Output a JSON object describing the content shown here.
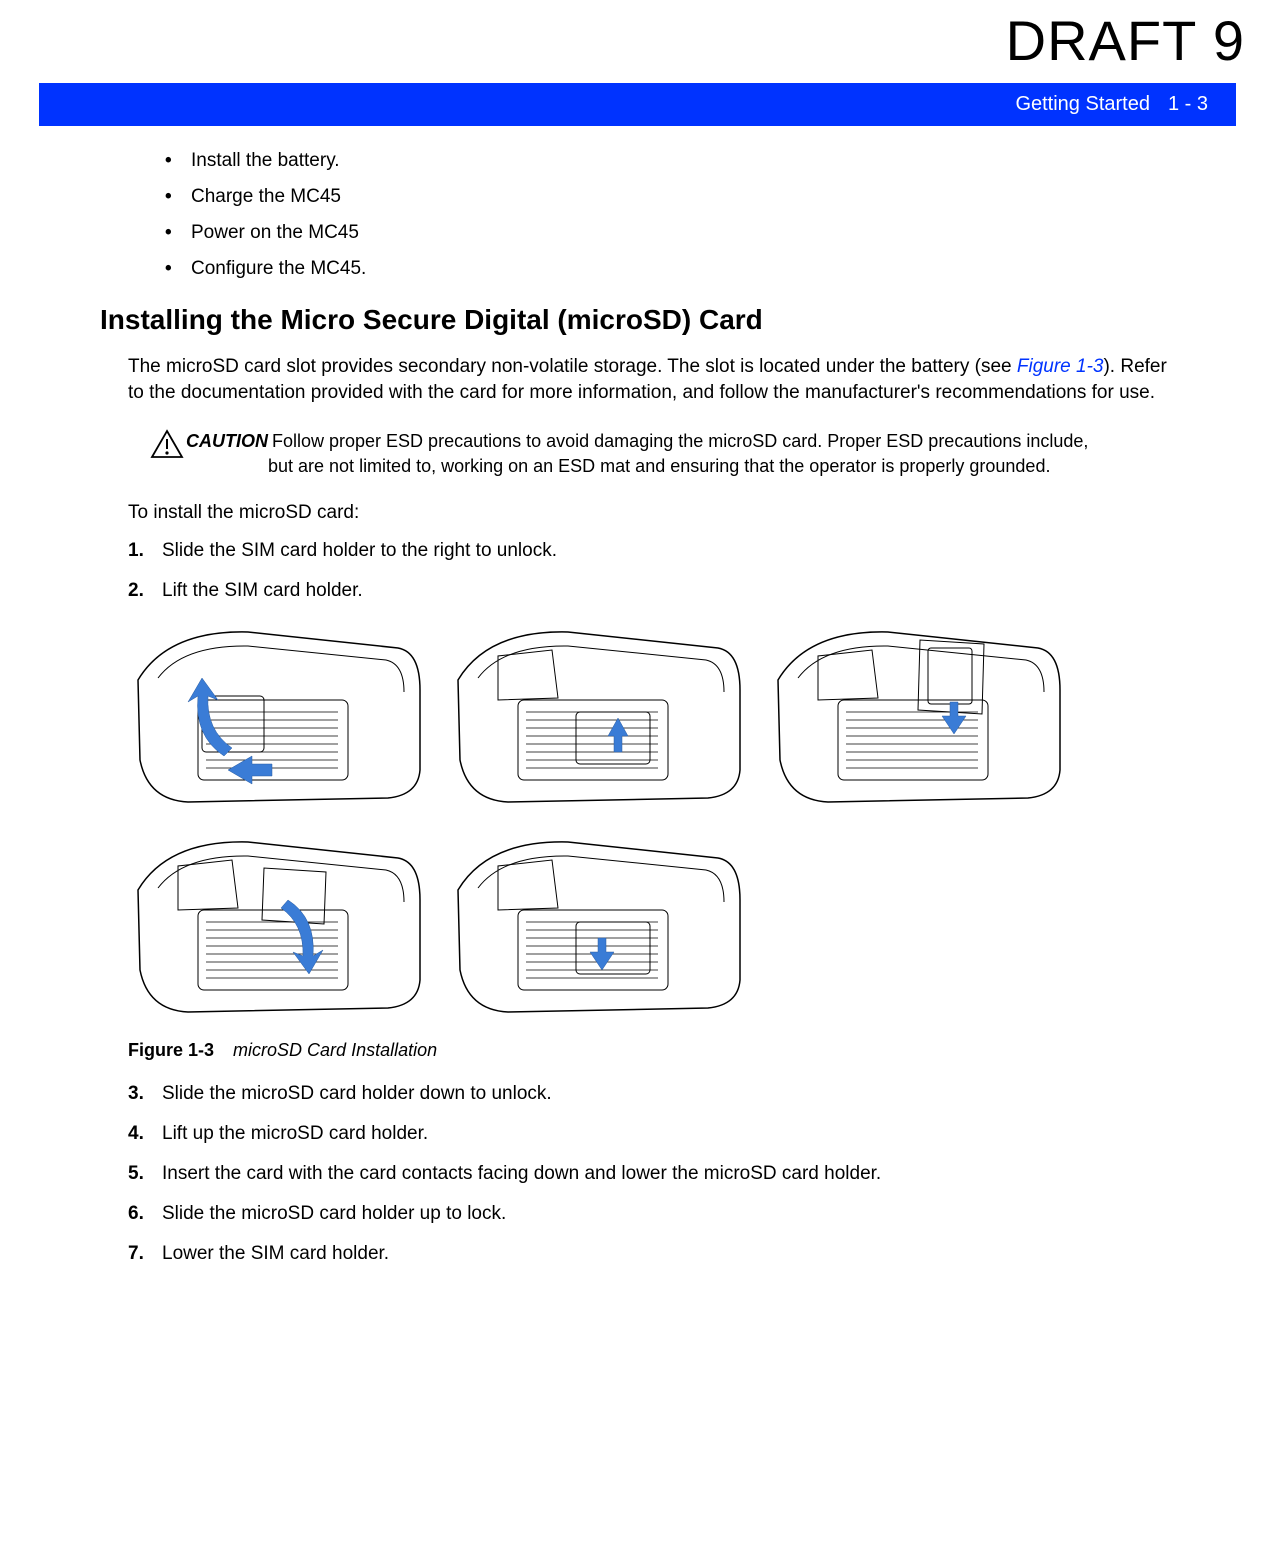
{
  "watermark": "DRAFT 9",
  "header": {
    "chapter": "Getting Started",
    "page": "1 - 3"
  },
  "top_bullets": [
    "Install the battery.",
    "Charge the MC45",
    "Power on the MC45",
    "Configure the MC45."
  ],
  "section_heading": "Installing the Micro Secure Digital (microSD) Card",
  "intro_para_pre": "The microSD card slot provides secondary non-volatile storage. The slot is located under the battery (see ",
  "intro_para_figref": "Figure 1-3",
  "intro_para_post": "). Refer to the documentation provided with the card for more information, and follow the manufacturer's recommendations for use.",
  "caution": {
    "keyword": "CAUTION",
    "line1": "Follow proper ESD precautions to avoid damaging the microSD card. Proper ESD precautions include,",
    "line2": "but are not limited to, working on an ESD mat and ensuring that the operator is properly grounded."
  },
  "lead_in": "To install the microSD card:",
  "steps_first": [
    {
      "n": "1.",
      "pre": "Slide",
      "rest": " the SIM card holder to the right to unlock."
    },
    {
      "n": "2.",
      "pre": "",
      "rest": "Lift the SIM card holder."
    }
  ],
  "figure": {
    "number": "Figure 1-3",
    "title": "microSD Card Installation"
  },
  "steps_rest": [
    {
      "n": "3.",
      "t": "Slide the microSD card holder down to unlock."
    },
    {
      "n": "4.",
      "t": "Lift up the microSD card holder."
    },
    {
      "n": "5.",
      "t": "Insert the card with the card contacts facing down and lower the microSD card holder."
    },
    {
      "n": "6.",
      "t": "Slide the microSD card holder up to lock."
    },
    {
      "n": "7.",
      "t": "Lower the SIM card holder."
    }
  ]
}
